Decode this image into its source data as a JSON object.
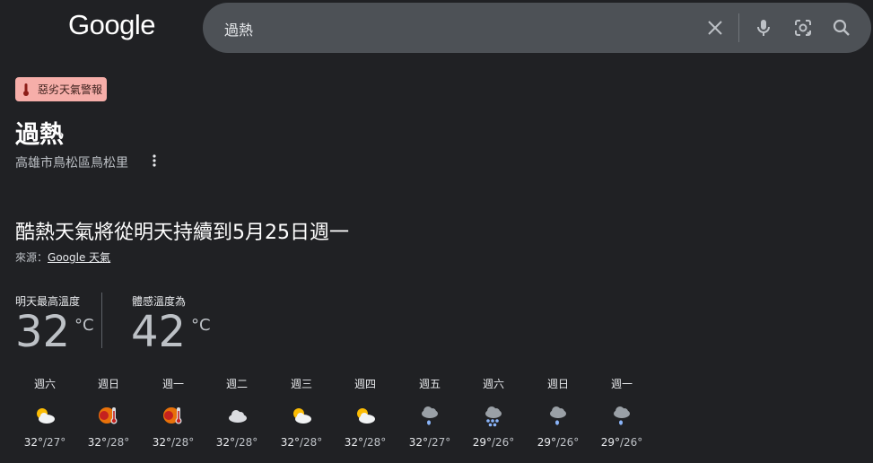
{
  "logo": "Google",
  "search": {
    "query": "過熱"
  },
  "alert": {
    "label": "惡劣天氣警報"
  },
  "result": {
    "title": "過熱",
    "location": "高雄市鳥松區鳥松里",
    "headline": "酷熱天氣將從明天持續到5月25日週一",
    "source_prefix": "來源：",
    "source_link": "Google 天氣"
  },
  "temps": {
    "high_label": "明天最高溫度",
    "high_value": "32",
    "feels_label": "體感溫度為",
    "feels_value": "42",
    "unit": "°C"
  },
  "forecast": [
    {
      "day": "週六",
      "icon": "partly-sunny-icon",
      "hi": "32°",
      "lo": "/27°"
    },
    {
      "day": "週日",
      "icon": "heat-icon",
      "hi": "32°",
      "lo": "/28°"
    },
    {
      "day": "週一",
      "icon": "heat-icon",
      "hi": "32°",
      "lo": "/28°"
    },
    {
      "day": "週二",
      "icon": "cloudy-icon",
      "hi": "32°",
      "lo": "/28°"
    },
    {
      "day": "週三",
      "icon": "partly-sunny-icon",
      "hi": "32°",
      "lo": "/28°"
    },
    {
      "day": "週四",
      "icon": "partly-sunny-icon",
      "hi": "32°",
      "lo": "/28°"
    },
    {
      "day": "週五",
      "icon": "rain-icon",
      "hi": "32°",
      "lo": "/27°"
    },
    {
      "day": "週六",
      "icon": "heavy-rain-icon",
      "hi": "29°",
      "lo": "/26°"
    },
    {
      "day": "週日",
      "icon": "rain-icon",
      "hi": "29°",
      "lo": "/26°"
    },
    {
      "day": "週一",
      "icon": "rain-icon",
      "hi": "29°",
      "lo": "/26°"
    }
  ]
}
